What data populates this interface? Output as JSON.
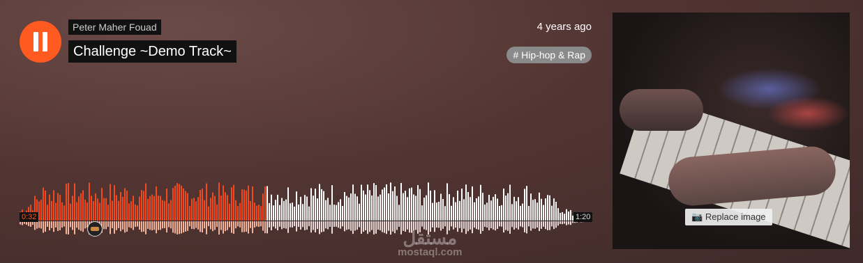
{
  "player": {
    "artist": "Peter Maher Fouad",
    "title": "Challenge ~Demo Track~",
    "posted": "4 years ago",
    "tag": "# Hip-hop & Rap",
    "current_time": "0:32",
    "duration": "1:20",
    "progress": 0.4,
    "state": "playing"
  },
  "artwork": {
    "replace_label": "Replace image"
  },
  "watermark": {
    "arabic": "مستقل",
    "latin": "mostaql.com"
  },
  "colors": {
    "accent": "#ff5a1f",
    "played_bar": "#f04a1e",
    "unplayed_bar": "#ffffff",
    "played_reflection": "#f5b49c",
    "unplayed_reflection": "#e9dcdb"
  },
  "icons": {
    "play_state": "pause-icon",
    "replace": "camera-icon"
  }
}
